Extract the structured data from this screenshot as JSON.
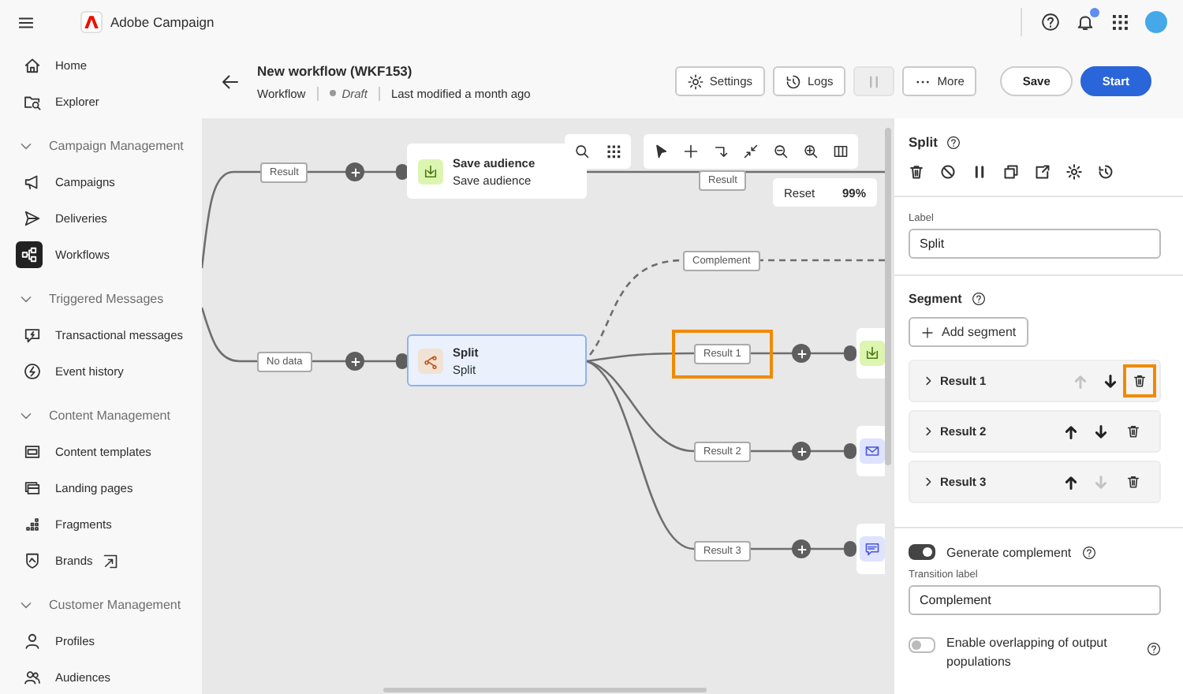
{
  "app": {
    "name": "Adobe Campaign",
    "has_notification": true
  },
  "sidebar": {
    "items": [
      {
        "label": "Home",
        "selected": false,
        "external": false
      },
      {
        "label": "Explorer",
        "selected": false,
        "external": false
      }
    ],
    "groups": [
      {
        "label": "Campaign Management",
        "expanded": true,
        "items": [
          {
            "label": "Campaigns",
            "selected": false,
            "external": false
          },
          {
            "label": "Deliveries",
            "selected": false,
            "external": false
          },
          {
            "label": "Workflows",
            "selected": true,
            "external": false
          }
        ]
      },
      {
        "label": "Triggered Messages",
        "expanded": true,
        "items": [
          {
            "label": "Transactional messages",
            "selected": false,
            "external": false
          },
          {
            "label": "Event history",
            "selected": false,
            "external": false
          }
        ]
      },
      {
        "label": "Content Management",
        "expanded": true,
        "items": [
          {
            "label": "Content templates",
            "selected": false,
            "external": false
          },
          {
            "label": "Landing pages",
            "selected": false,
            "external": false
          },
          {
            "label": "Fragments",
            "selected": false,
            "external": false
          },
          {
            "label": "Brands",
            "selected": false,
            "external": true
          }
        ]
      },
      {
        "label": "Customer Management",
        "expanded": true,
        "items": [
          {
            "label": "Profiles",
            "selected": false,
            "external": false
          },
          {
            "label": "Audiences",
            "selected": false,
            "external": false
          }
        ]
      }
    ]
  },
  "header": {
    "title": "New workflow (WKF153)",
    "type": "Workflow",
    "status": "Draft",
    "modified": "Last modified a month ago",
    "buttons": [
      {
        "kind": "settings",
        "label": "Settings",
        "disabled": false
      },
      {
        "kind": "logs",
        "label": "Logs",
        "disabled": false
      },
      {
        "kind": "pause",
        "disabled": true
      },
      {
        "kind": "more",
        "label": "More",
        "disabled": false
      },
      {
        "kind": "save",
        "label": "Save",
        "disabled": false
      },
      {
        "kind": "start",
        "label": "Start",
        "disabled": false
      }
    ]
  },
  "canvas": {
    "reset": "Reset",
    "zoom": "99%",
    "transitions": [
      {
        "label": "Result",
        "highlighted": false
      },
      {
        "label": "No data",
        "highlighted": false
      },
      {
        "label": "Result",
        "highlighted": false
      },
      {
        "label": "Complement",
        "highlighted": false
      },
      {
        "label": "Result 1",
        "highlighted": true
      },
      {
        "label": "Result 2",
        "highlighted": false
      },
      {
        "label": "Result 3",
        "highlighted": false
      }
    ],
    "nodes": [
      {
        "kind": "save",
        "title": "Save audience",
        "subtitle": "Save audience",
        "selected": false
      },
      {
        "kind": "split",
        "title": "Split",
        "subtitle": "Split",
        "selected": true
      },
      {
        "kind": "save",
        "selected": false
      },
      {
        "kind": "email",
        "selected": false
      },
      {
        "kind": "sms",
        "selected": false
      }
    ]
  },
  "panel": {
    "title": "Split",
    "label_field": {
      "label": "Label",
      "value": "Split"
    },
    "segment": {
      "title": "Segment",
      "add_button": "Add segment",
      "segments": [
        {
          "name": "Result 1",
          "up_disabled": true,
          "down_disabled": false,
          "highlighted": true
        },
        {
          "name": "Result 2",
          "up_disabled": false,
          "down_disabled": false,
          "highlighted": false
        },
        {
          "name": "Result 3",
          "up_disabled": false,
          "down_disabled": true,
          "highlighted": false
        }
      ]
    },
    "complement": {
      "label": "Generate complement",
      "on": true,
      "transition_label": "Transition label",
      "value": "Complement"
    },
    "overlap": {
      "label": "Enable overlapping of output populations",
      "on": false
    }
  }
}
